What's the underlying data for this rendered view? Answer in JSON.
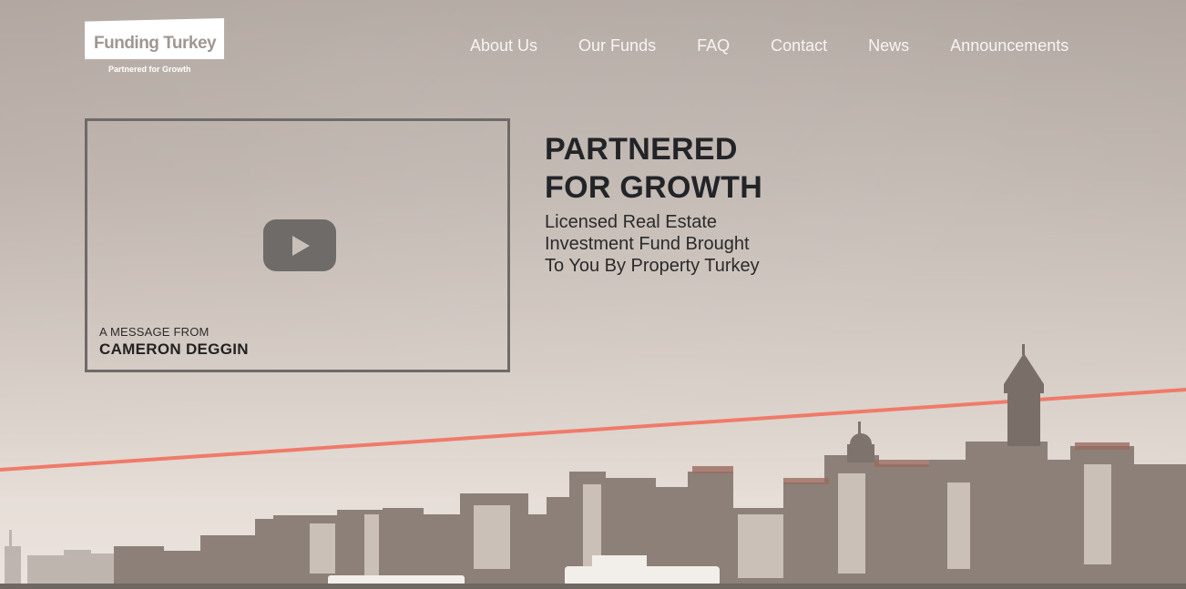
{
  "header": {
    "logo_text": "Funding Turkey",
    "logo_tagline": "Partnered for Growth"
  },
  "nav": {
    "items": [
      "About Us",
      "Our Funds",
      "FAQ",
      "Contact",
      "News",
      "Announcements"
    ]
  },
  "video": {
    "caption_pre": "A MESSAGE FROM",
    "caption_name": "CAMERON DEGGIN"
  },
  "hero": {
    "title_line1": "PARTNERED",
    "title_line2": "FOR GROWTH",
    "subtitle_line1": "Licensed Real Estate",
    "subtitle_line2": "Investment Fund Brought",
    "subtitle_line3": "To You By Property Turkey"
  },
  "colors": {
    "accent_line": "#f07a6a",
    "text_dark": "#222428",
    "nav_text": "#f7f4f2"
  },
  "icons": {
    "play": "play-button-icon"
  }
}
